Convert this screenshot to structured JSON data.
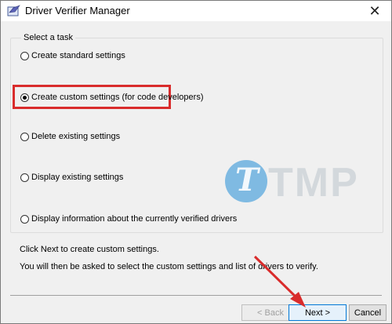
{
  "window": {
    "title": "Driver Verifier Manager",
    "close_glyph": "✕"
  },
  "group": {
    "label": "Select a task"
  },
  "options": [
    {
      "label": "Create standard settings",
      "selected": false
    },
    {
      "label": "Create custom settings (for code developers)",
      "selected": true
    },
    {
      "label": "Delete existing settings",
      "selected": false
    },
    {
      "label": "Display existing settings",
      "selected": false
    },
    {
      "label": "Display information about the currently verified drivers",
      "selected": false
    }
  ],
  "info": {
    "line1": "Click Next to create custom settings.",
    "line2": "You will then be asked to select the custom settings and list of drivers to verify."
  },
  "buttons": {
    "back": "< Back",
    "next": "Next >",
    "cancel": "Cancel"
  },
  "watermark": {
    "letter": "T",
    "text": "TMP"
  },
  "colors": {
    "highlight": "#d92c2c",
    "arrow": "#d92c2c",
    "watermark_circle": "#5aa8dd"
  }
}
